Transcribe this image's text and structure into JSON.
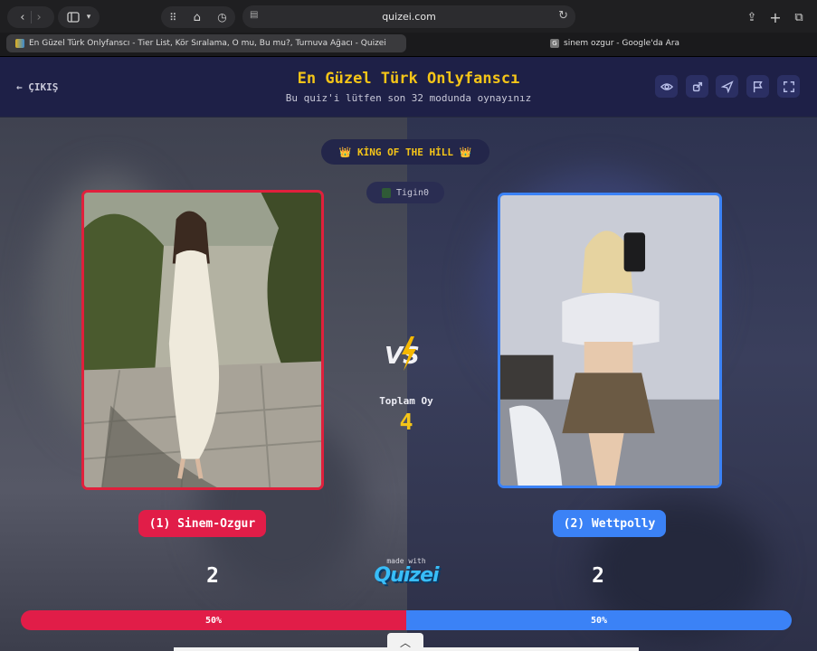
{
  "browser": {
    "address": "quizei.com",
    "tabs": [
      {
        "label": "En Güzel Türk Onlyfanscı - Tier List, Kör Sıralama, O mu, Bu mu?, Turnuva Ağacı - Quizei",
        "active": true
      },
      {
        "label": "sinem ozgur - Google'da Ara",
        "active": false
      }
    ]
  },
  "header": {
    "exit_label": "← ÇIKIŞ",
    "title": "En Güzel Türk Onlyfanscı",
    "subtitle": "Bu quiz'i lütfen son 32 modunda oynayınız",
    "actions": [
      "eye-icon",
      "share-icon",
      "send-icon",
      "flag-icon",
      "fullscreen-icon"
    ]
  },
  "arena": {
    "mode_badge": "👑 KİNG OF THE HİLL 👑",
    "creator": "Tigin0",
    "votes_label": "Toplam Oy",
    "votes_total": "4",
    "vs_label": "VS",
    "left": {
      "name": "(1) Sinem-Ozgur",
      "score": "2",
      "percent": "50%",
      "share": 0.5
    },
    "right": {
      "name": "(2) Wettpolly",
      "score": "2",
      "percent": "50%",
      "share": 0.5
    },
    "made_with": "made with",
    "logo": "Quizei"
  },
  "colors": {
    "left": "#e11d48",
    "right": "#3b82f6",
    "accent": "#f5c518"
  }
}
